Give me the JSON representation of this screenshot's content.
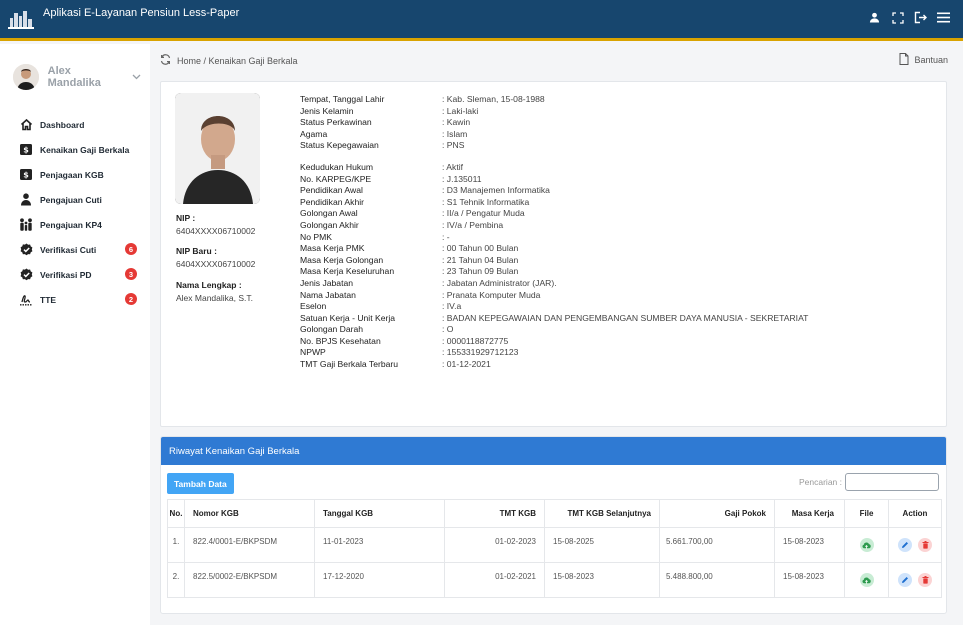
{
  "app": {
    "title": "Aplikasi E-Layanan Pensiun Less-Paper"
  },
  "user": {
    "name": "Alex Mandalika"
  },
  "sidebar": {
    "items": [
      {
        "label": "Dashboard",
        "icon": "home-icon"
      },
      {
        "label": "Kenaikan Gaji Berkala",
        "icon": "dollar-icon"
      },
      {
        "label": "Penjagaan KGB",
        "icon": "dollar-icon"
      },
      {
        "label": "Pengajuan Cuti",
        "icon": "person-icon"
      },
      {
        "label": "Pengajuan KP4",
        "icon": "family-icon"
      },
      {
        "label": "Verifikasi Cuti",
        "icon": "check-badge-icon",
        "badge": "6"
      },
      {
        "label": "Verifikasi PD",
        "icon": "check-badge-icon",
        "badge": "3"
      },
      {
        "label": "TTE",
        "icon": "signature-icon",
        "badge": "2"
      }
    ]
  },
  "breadcrumb": {
    "text": "Home / Kenaikan Gaji Berkala",
    "help": "Bantuan"
  },
  "profile": {
    "nip_label": "NIP :",
    "nip": "6404XXXX06710002",
    "nip_baru_label": "NIP Baru :",
    "nip_baru": "6404XXXX06710002",
    "nama_label": "Nama Lengkap :",
    "nama": "Alex Mandalika, S.T.",
    "fields_a": [
      {
        "label": "Tempat, Tanggal Lahir",
        "value": ": Kab. Sleman, 15-08-1988"
      },
      {
        "label": "Jenis Kelamin",
        "value": ": Laki-laki"
      },
      {
        "label": "Status Perkawinan",
        "value": ": Kawin"
      },
      {
        "label": "Agama",
        "value": ": Islam"
      },
      {
        "label": "Status Kepegawaian",
        "value": ": PNS"
      }
    ],
    "fields_b": [
      {
        "label": "Kedudukan Hukum",
        "value": ": Aktif"
      },
      {
        "label": "No. KARPEG/KPE",
        "value": ": J.135011"
      },
      {
        "label": "Pendidikan Awal",
        "value": ": D3 Manajemen Informatika"
      },
      {
        "label": "Pendidikan Akhir",
        "value": ": S1 Tehnik Informatika"
      },
      {
        "label": "Golongan Awal",
        "value": ": II/a / Pengatur Muda"
      },
      {
        "label": "Golongan Akhir",
        "value": ": IV/a / Pembina"
      },
      {
        "label": "No PMK",
        "value": ": -"
      },
      {
        "label": "Masa Kerja PMK",
        "value": ": 00 Tahun 00 Bulan"
      },
      {
        "label": "Masa Kerja Golongan",
        "value": ": 21 Tahun 04 Bulan"
      },
      {
        "label": "Masa Kerja Keseluruhan",
        "value": ": 23 Tahun 09 Bulan"
      },
      {
        "label": "Jenis Jabatan",
        "value": ": Jabatan Administrator (JAR)."
      },
      {
        "label": "Nama Jabatan",
        "value": ": Pranata Komputer Muda"
      },
      {
        "label": "Eselon",
        "value": ": IV.a"
      },
      {
        "label": "Satuan Kerja - Unit Kerja",
        "value": ": BADAN KEPEGAWAIAN DAN PENGEMBANGAN SUMBER DAYA MANUSIA - SEKRETARIAT"
      },
      {
        "label": "Golongan Darah",
        "value": ": O"
      },
      {
        "label": "No. BPJS Kesehatan",
        "value": ": 0000118872775"
      },
      {
        "label": "NPWP",
        "value": ": 155331929712123"
      },
      {
        "label": "TMT Gaji Berkala Terbaru",
        "value": ": 01-12-2021"
      }
    ]
  },
  "history": {
    "title": "Riwayat Kenaikan Gaji Berkala",
    "add_label": "Tambah Data",
    "search_label": "Pencarian :",
    "search_value": "",
    "columns": [
      "No.",
      "Nomor KGB",
      "Tanggal KGB",
      "TMT KGB",
      "TMT KGB Selanjutnya",
      "Gaji Pokok",
      "Masa Kerja",
      "File",
      "Action"
    ],
    "rows": [
      [
        "1.",
        "822.4/0001-E/BKPSDM",
        "11-01-2023",
        "01-02-2023",
        "15-08-2025",
        "5.661.700,00",
        "15-08-2023"
      ],
      [
        "2.",
        "822.5/0002-E/BKPSDM",
        "17-12-2020",
        "01-02-2021",
        "15-08-2023",
        "5.488.800,00",
        "15-08-2023"
      ]
    ]
  }
}
